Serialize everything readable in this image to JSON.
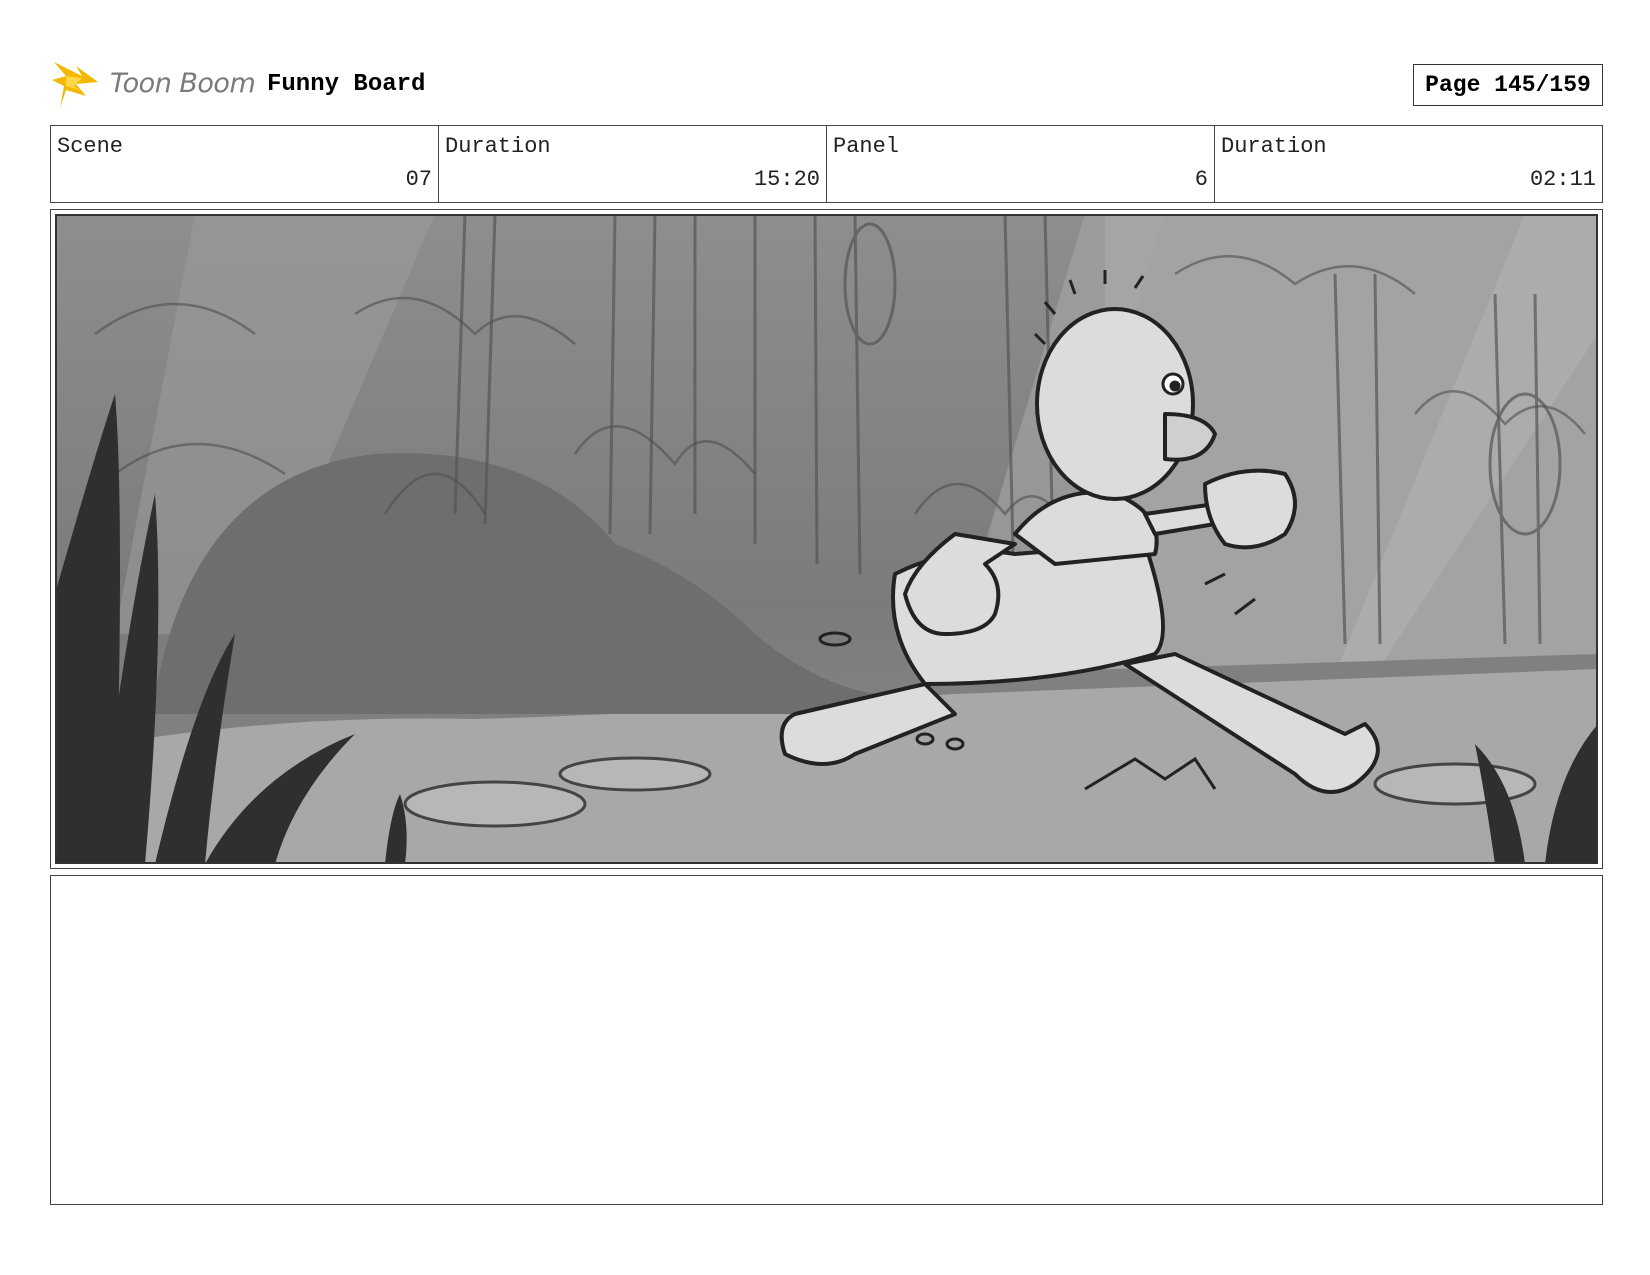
{
  "header": {
    "logo_text": "Toon Boom",
    "board_title": "Funny Board",
    "page_label": "Page 145/159"
  },
  "info": {
    "scene_label": "Scene",
    "scene_value": "07",
    "scene_duration_label": "Duration",
    "scene_duration_value": "15:20",
    "panel_label": "Panel",
    "panel_value": "6",
    "panel_duration_label": "Duration",
    "panel_duration_value": "02:11"
  },
  "panel": {
    "image": "storyboard-sketch-character-running-through-jungle"
  },
  "caption": {
    "text": ""
  },
  "colors": {
    "logo_flash": "#f5b800",
    "logo_text": "#7a7a7a",
    "border": "#444444"
  }
}
